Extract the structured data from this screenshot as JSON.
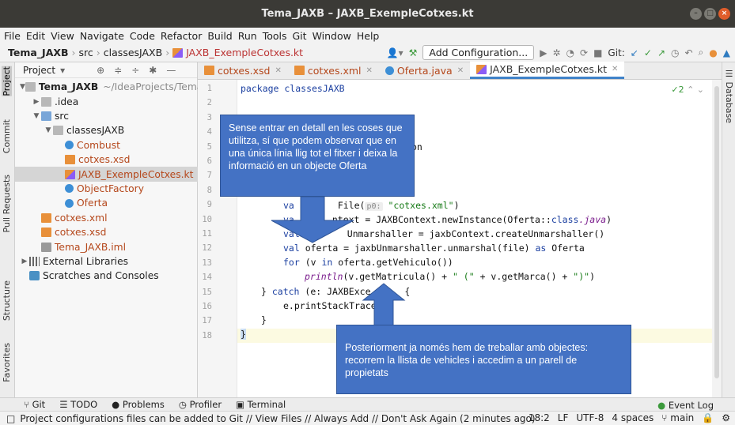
{
  "window": {
    "title": "Tema_JAXB – JAXB_ExempleCotxes.kt"
  },
  "menu": [
    "File",
    "Edit",
    "View",
    "Navigate",
    "Code",
    "Refactor",
    "Build",
    "Run",
    "Tools",
    "Git",
    "Window",
    "Help"
  ],
  "breadcrumb": [
    "Tema_JAXB",
    "src",
    "classesJAXB",
    "JAXB_ExempleCotxes.kt"
  ],
  "toolbar": {
    "add_configuration": "Add Configuration...",
    "git_label": "Git:"
  },
  "left_tabs": [
    "Project",
    "Commit",
    "Pull Requests",
    "Structure",
    "Favorites"
  ],
  "right_tabs": [
    "Database"
  ],
  "project_panel": {
    "header": "Project",
    "tree": [
      {
        "label": "Tema_JAXB",
        "extra": "~/IdeaProjects/Tema",
        "depth": 0,
        "arrow": "▼",
        "icon": "folder",
        "bold": true
      },
      {
        "label": ".idea",
        "depth": 1,
        "arrow": "▶",
        "icon": "folder"
      },
      {
        "label": "src",
        "depth": 1,
        "arrow": "▼",
        "icon": "folder-src"
      },
      {
        "label": "classesJAXB",
        "depth": 2,
        "arrow": "▼",
        "icon": "folder"
      },
      {
        "label": "Combust",
        "depth": 3,
        "icon": "class"
      },
      {
        "label": "cotxes.xsd",
        "depth": 3,
        "icon": "xml"
      },
      {
        "label": "JAXB_ExempleCotxes.kt",
        "depth": 3,
        "icon": "kt",
        "selected": true
      },
      {
        "label": "ObjectFactory",
        "depth": 3,
        "icon": "class"
      },
      {
        "label": "Oferta",
        "depth": 3,
        "icon": "class"
      },
      {
        "label": "cotxes.xml",
        "depth": 1,
        "icon": "xml"
      },
      {
        "label": "cotxes.xsd",
        "depth": 1,
        "icon": "xml"
      },
      {
        "label": "Tema_JAXB.iml",
        "depth": 1,
        "icon": "iml"
      },
      {
        "label": "External Libraries",
        "depth": 0,
        "arrow": "▶",
        "icon": "lib",
        "plain": true
      },
      {
        "label": "Scratches and Consoles",
        "depth": 0,
        "icon": "scratch",
        "plain": true
      }
    ]
  },
  "editor_tabs": [
    {
      "label": "cotxes.xsd",
      "active": false
    },
    {
      "label": "cotxes.xml",
      "active": false
    },
    {
      "label": "Oferta.java",
      "active": false
    },
    {
      "label": "JAXB_ExempleCotxes.kt",
      "active": true
    }
  ],
  "editor": {
    "inspection_count": "2",
    "line_numbers": [
      "1",
      "2",
      "3",
      "4",
      "5",
      "6",
      "7",
      "8",
      "9",
      "10",
      "11",
      "12",
      "13",
      "14",
      "15",
      "16",
      "17",
      "18"
    ],
    "visible_code": {
      "l1": "package classesJAXB",
      "l6_tail": "on",
      "l9a": "va",
      "l9b": "File(",
      "l9_hint": "p0:",
      "l9_str": "\"cotxes.xml\"",
      "l10a": "va",
      "l10b": "ntext = JAXBContext.newInstance(Oferta::",
      "l10_kw": "class",
      "l10_fn": ".java",
      "l11a": "val",
      "l11b": "Unmarshaller = jaxbContext.createUnmarshaller()",
      "l12a": "val",
      "l12b": " oferta = jaxbUnmarshaller.unmarshal(file) ",
      "l12_kw": "as",
      "l12c": " Oferta",
      "l13a": "for",
      "l13b": " (v ",
      "l13_kw": "in",
      "l13c": " oferta.getVehiculo())",
      "l14_fn": "println",
      "l14b": "(v.getMatricula() + ",
      "l14_s1": "\" (\"",
      "l14c": " + v.getMarca() + ",
      "l14_s2": "\")\"",
      "l14d": ")",
      "l15_kw": "catch",
      "l15b": " (e: JAXBExce",
      "l15c": " {",
      "l16": "e.printStackTrace",
      "l17": "}",
      "l18": "}"
    }
  },
  "callouts": {
    "top": "Sense entrar en detall en les coses que utilitza, sí que podem observar que en una única línia llig tot el fitxer i deixa la informació en un objecte Oferta",
    "bottom": "Posteriorment ja només hem de treballar amb objectes: recorrem la llista de vehicles i accedim a un parell de propietats"
  },
  "tool_windows": [
    "Git",
    "TODO",
    "Problems",
    "Profiler",
    "Terminal"
  ],
  "event_log": "Event Log",
  "status": {
    "message": "Project configurations files can be added to Git // View Files // Always Add // Don't Ask Again (2 minutes ago)",
    "position": "18:2",
    "line_sep": "LF",
    "encoding": "UTF-8",
    "indent": "4 spaces",
    "branch": "main"
  }
}
